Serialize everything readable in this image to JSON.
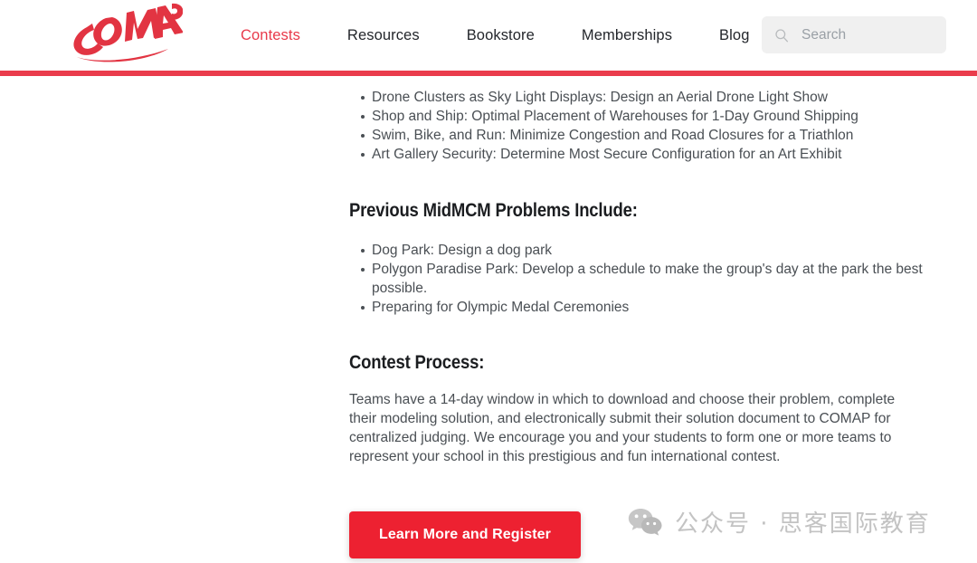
{
  "header": {
    "logo_text": "COMAP",
    "logo_color": "#e23442",
    "accent_color": "#ea3c4c",
    "nav": [
      {
        "label": "Contests",
        "active": true
      },
      {
        "label": "Resources",
        "active": false
      },
      {
        "label": "Bookstore",
        "active": false
      },
      {
        "label": "Memberships",
        "active": false
      },
      {
        "label": "Blog",
        "active": false
      }
    ],
    "search": {
      "placeholder": "Search",
      "value": "",
      "icon": "search-icon"
    }
  },
  "main": {
    "clipped_line": "partially obscured problem title line",
    "problem_list": [
      "Drone Clusters as Sky Light Displays: Design an Aerial Drone Light Show",
      "Shop and Ship: Optimal Placement of Warehouses for 1-Day Ground Shipping",
      "Swim, Bike, and Run: Minimize Congestion and Road Closures for a Triathlon",
      "Art Gallery Security: Determine Most Secure Configuration for an Art Exhibit"
    ],
    "previous_heading": "Previous MidMCM Problems Include:",
    "previous_list": [
      "Dog Park: Design a dog park",
      "Polygon Paradise Park: Develop a schedule to make the group's day at the park the best possible.",
      "Preparing for Olympic Medal Ceremonies"
    ],
    "process_heading": "Contest Process:",
    "process_paragraph": "Teams have a 14-day window in which to download and choose their problem, complete their modeling solution, and electronically submit their solution document to COMAP for centralized judging. We encourage you and your students to form one or more teams to represent your school in this prestigious and fun international contest.",
    "cta_label": "Learn More and Register",
    "cta_color": "#ed2131"
  },
  "watermark": {
    "icon": "wechat-icon",
    "text": "公众号 · 思客国际教育",
    "color": "#c3c3c3"
  }
}
